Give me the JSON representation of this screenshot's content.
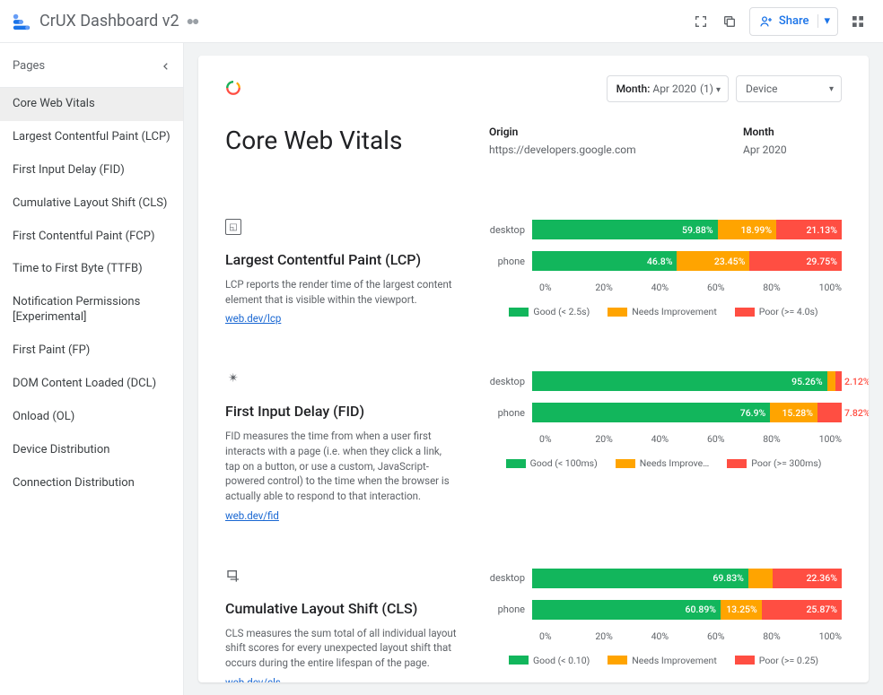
{
  "app": {
    "title": "CrUX Dashboard v2",
    "share_label": "Share"
  },
  "sidebar": {
    "title": "Pages",
    "items": [
      {
        "label": "Core Web Vitals",
        "selected": true
      },
      {
        "label": "Largest Contentful Paint (LCP)"
      },
      {
        "label": "First Input Delay (FID)"
      },
      {
        "label": "Cumulative Layout Shift (CLS)"
      },
      {
        "label": "First Contentful Paint (FCP)"
      },
      {
        "label": "Time to First Byte (TTFB)"
      },
      {
        "label": "Notification Permissions [Experimental]"
      },
      {
        "label": "First Paint (FP)"
      },
      {
        "label": "DOM Content Loaded (DCL)"
      },
      {
        "label": "Onload (OL)"
      },
      {
        "label": "Device Distribution"
      },
      {
        "label": "Connection Distribution"
      }
    ]
  },
  "filters": {
    "month_label": "Month:",
    "month_value": "Apr 2020",
    "month_count": "(1)",
    "device_label": "Device"
  },
  "hero": {
    "title": "Core Web Vitals",
    "origin_label": "Origin",
    "origin_value": "https://developers.google.com",
    "month_label": "Month",
    "month_value": "Apr 2020"
  },
  "metrics": [
    {
      "id": "lcp",
      "title": "Largest Contentful Paint (LCP)",
      "desc": "LCP reports the render time of the largest content element that is visible within the viewport.",
      "link": "web.dev/lcp",
      "legend": [
        "Good (< 2.5s)",
        "Needs Improvement",
        "Poor (>= 4.0s)"
      ]
    },
    {
      "id": "fid",
      "title": "First Input Delay (FID)",
      "desc": "FID measures the time from when a user first interacts with a page (i.e. when they click a link, tap on a button, or use a custom, JavaScript-powered control) to the time when the browser is actually able to respond to that interaction.",
      "link": "web.dev/fid",
      "legend": [
        "Good (< 100ms)",
        "Needs Improve…",
        "Poor (>= 300ms)"
      ]
    },
    {
      "id": "cls",
      "title": "Cumulative Layout Shift (CLS)",
      "desc": "CLS measures the sum total of all individual layout shift scores for every unexpected layout shift that occurs during the entire lifespan of the page.",
      "link": "web.dev/cls",
      "legend": [
        "Good (< 0.10)",
        "Needs Improvement",
        "Poor (>= 0.25)"
      ]
    }
  ],
  "chart_data": [
    {
      "type": "bar",
      "metric": "lcp",
      "title": "Largest Contentful Paint (LCP)",
      "xlabel": "",
      "ylabel": "",
      "xlim": [
        0,
        100
      ],
      "ticks": [
        "0%",
        "20%",
        "40%",
        "60%",
        "80%",
        "100%"
      ],
      "categories": [
        "desktop",
        "phone"
      ],
      "series": [
        {
          "name": "Good (< 2.5s)",
          "values": [
            59.88,
            46.8
          ]
        },
        {
          "name": "Needs Improvement",
          "values": [
            18.99,
            23.45
          ]
        },
        {
          "name": "Poor (>= 4.0s)",
          "values": [
            21.13,
            29.75
          ]
        }
      ],
      "labels": [
        {
          "good": "59.88%",
          "ni": "18.99%",
          "poor": "21.13%"
        },
        {
          "good": "46.8%",
          "ni": "23.45%",
          "poor": "29.75%"
        }
      ]
    },
    {
      "type": "bar",
      "metric": "fid",
      "title": "First Input Delay (FID)",
      "xlabel": "",
      "ylabel": "",
      "xlim": [
        0,
        100
      ],
      "ticks": [
        "0%",
        "20%",
        "40%",
        "60%",
        "80%",
        "100%"
      ],
      "categories": [
        "desktop",
        "phone"
      ],
      "series": [
        {
          "name": "Good (< 100ms)",
          "values": [
            95.26,
            76.9
          ]
        },
        {
          "name": "Needs Improve…",
          "values": [
            2.62,
            15.28
          ]
        },
        {
          "name": "Poor (>= 300ms)",
          "values": [
            2.12,
            7.82
          ]
        }
      ],
      "labels": [
        {
          "good": "95.26%",
          "ni": "",
          "poor": "2.12%",
          "poor_out": true,
          "ni_out": false
        },
        {
          "good": "76.9%",
          "ni": "15.28%",
          "poor": "7.82%",
          "poor_out": true
        }
      ]
    },
    {
      "type": "bar",
      "metric": "cls",
      "title": "Cumulative Layout Shift (CLS)",
      "xlabel": "",
      "ylabel": "",
      "xlim": [
        0,
        100
      ],
      "ticks": [
        "0%",
        "20%",
        "40%",
        "60%",
        "80%",
        "100%"
      ],
      "categories": [
        "desktop",
        "phone"
      ],
      "series": [
        {
          "name": "Good (< 0.10)",
          "values": [
            69.83,
            60.89
          ]
        },
        {
          "name": "Needs Improvement",
          "values": [
            7.81,
            13.25
          ]
        },
        {
          "name": "Poor (>= 0.25)",
          "values": [
            22.36,
            25.87
          ]
        }
      ],
      "labels": [
        {
          "good": "69.83%",
          "ni": "7.81",
          "ni_out": true,
          "poor": "22.36%"
        },
        {
          "good": "60.89%",
          "ni": "13.25%",
          "poor": "25.87%"
        }
      ]
    }
  ]
}
